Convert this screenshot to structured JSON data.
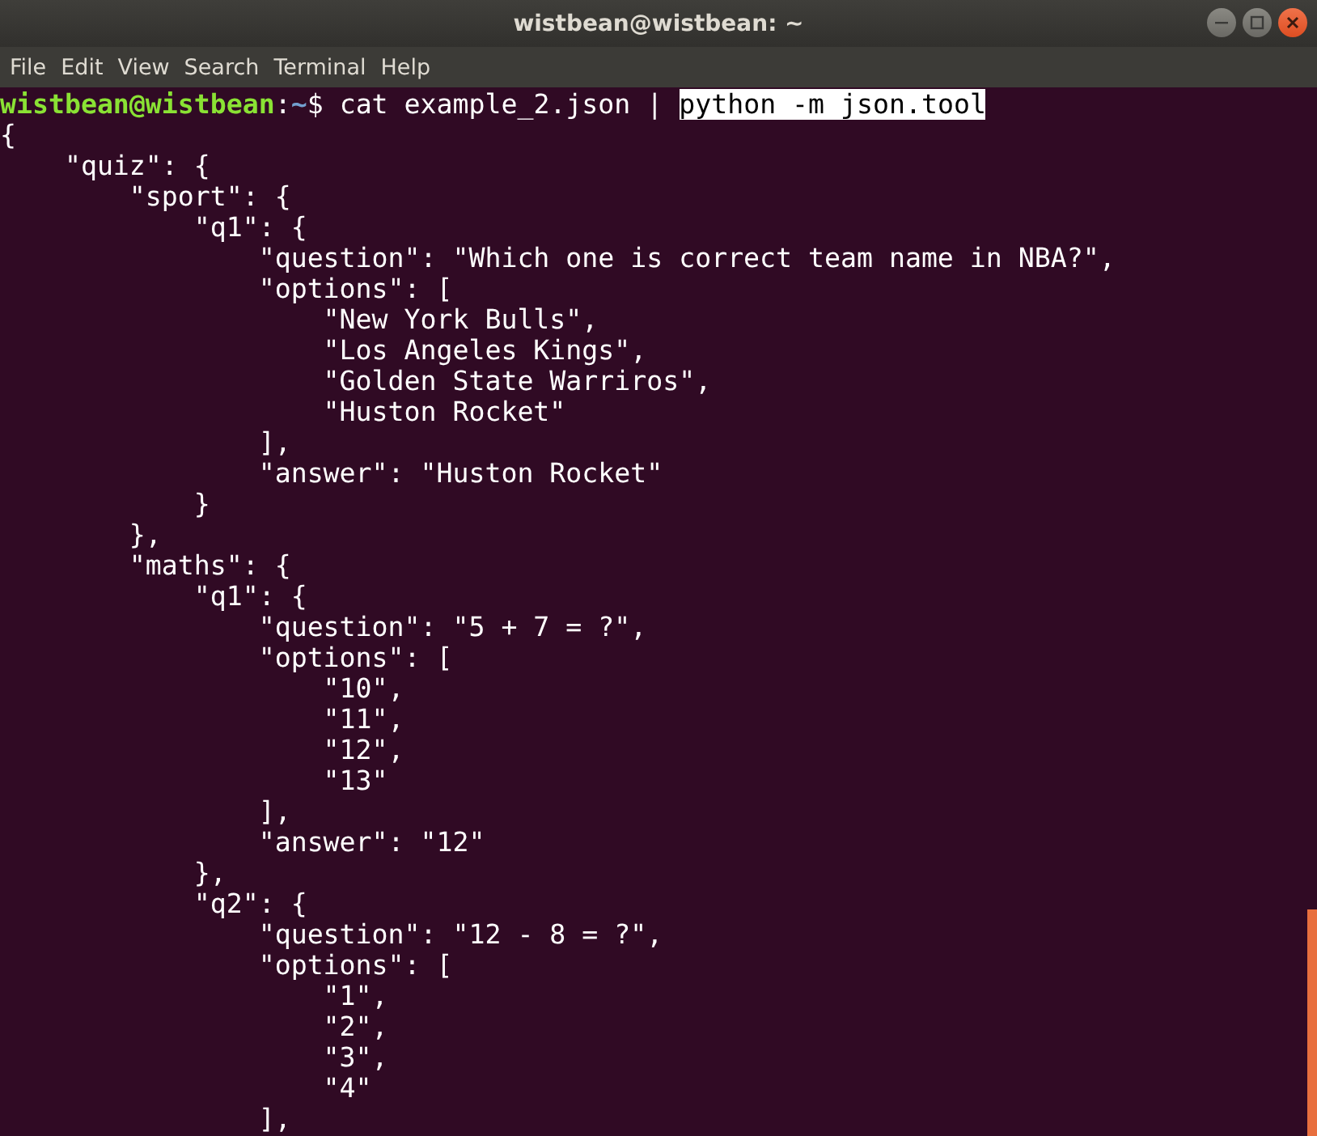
{
  "window": {
    "title": "wistbean@wistbean: ~"
  },
  "menu": [
    "File",
    "Edit",
    "View",
    "Search",
    "Terminal",
    "Help"
  ],
  "prompt": {
    "user": "wistbean@wistbean",
    "separator": ":",
    "path": "~",
    "symbol": "$",
    "command": "cat example_2.json |",
    "selection": "python -m json.tool"
  },
  "output": [
    "{",
    "    \"quiz\": {",
    "        \"sport\": {",
    "            \"q1\": {",
    "                \"question\": \"Which one is correct team name in NBA?\",",
    "                \"options\": [",
    "                    \"New York Bulls\",",
    "                    \"Los Angeles Kings\",",
    "                    \"Golden State Warriros\",",
    "                    \"Huston Rocket\"",
    "                ],",
    "                \"answer\": \"Huston Rocket\"",
    "            }",
    "        },",
    "        \"maths\": {",
    "            \"q1\": {",
    "                \"question\": \"5 + 7 = ?\",",
    "                \"options\": [",
    "                    \"10\",",
    "                    \"11\",",
    "                    \"12\",",
    "                    \"13\"",
    "                ],",
    "                \"answer\": \"12\"",
    "            },",
    "            \"q2\": {",
    "                \"question\": \"12 - 8 = ?\",",
    "                \"options\": [",
    "                    \"1\",",
    "                    \"2\",",
    "                    \"3\",",
    "                    \"4\"",
    "                ],"
  ]
}
